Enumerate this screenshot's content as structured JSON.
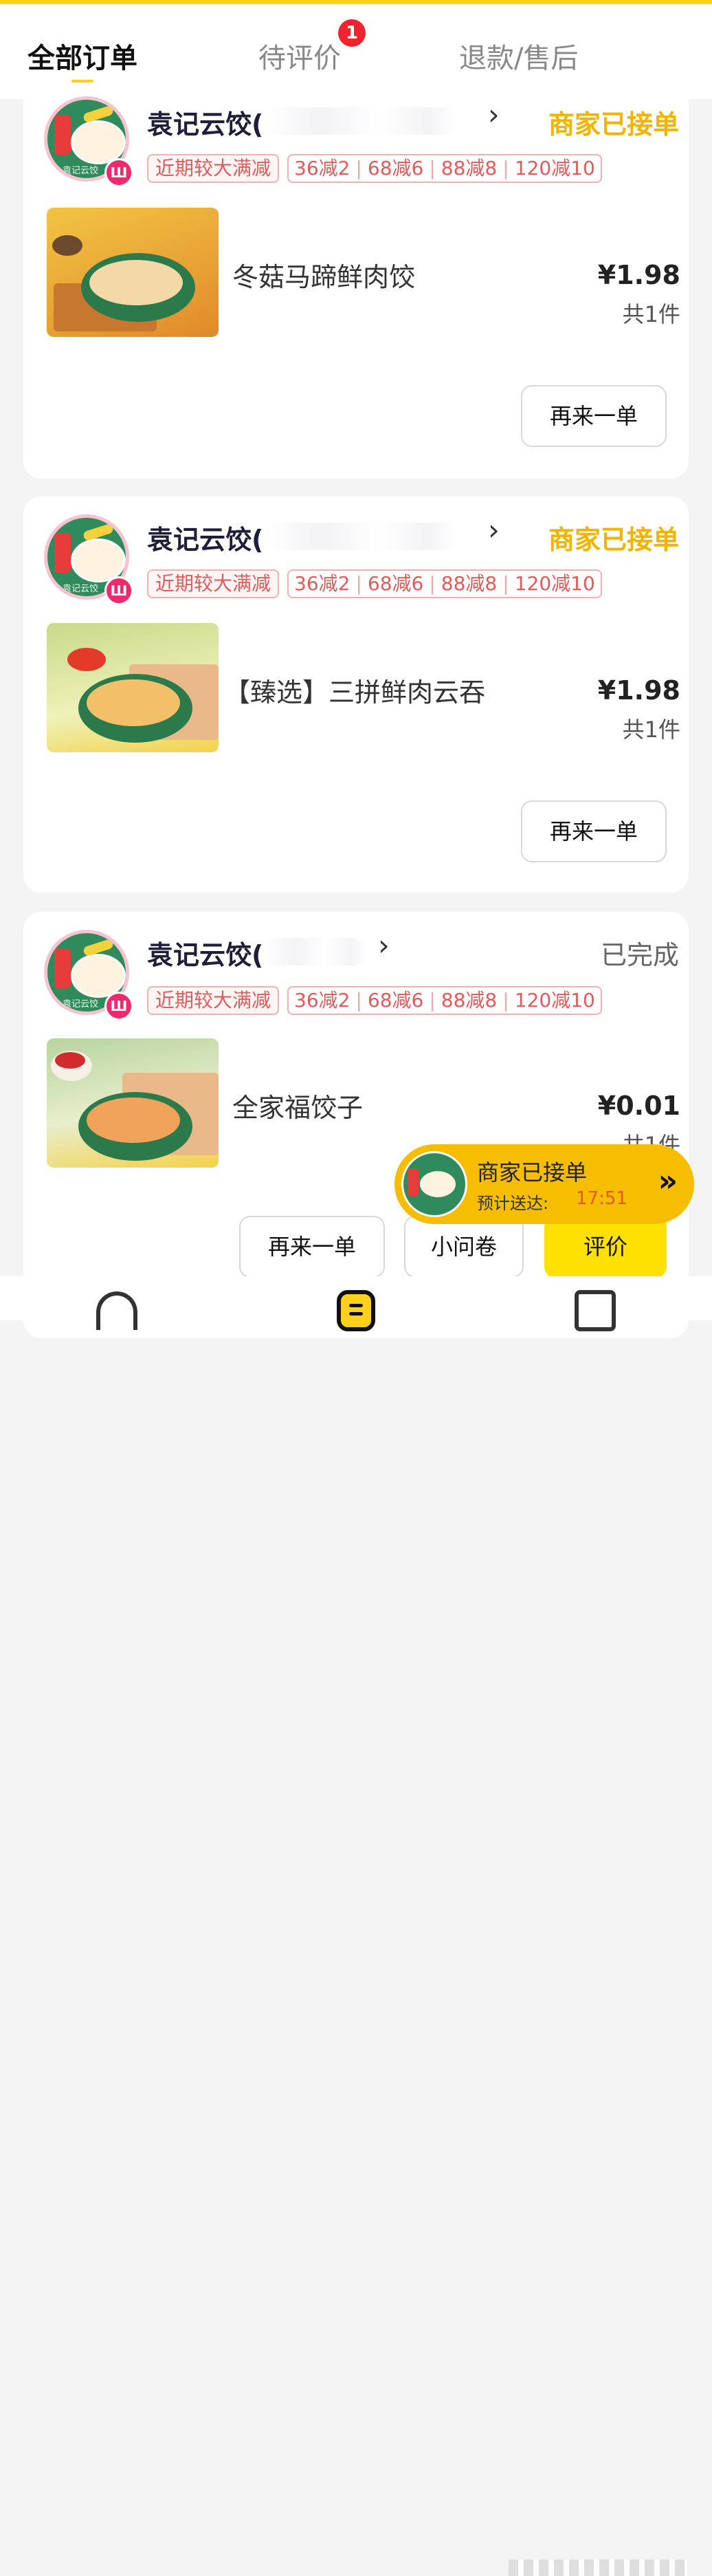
{
  "tabs": {
    "all": "全部订单",
    "review": "待评价",
    "review_badge": "1",
    "refund": "退款/售后"
  },
  "orders": [
    {
      "store_name": "袁记云饺(",
      "status": "商家已接单",
      "promo_label": "近期较大满减",
      "promos": [
        "36减2",
        "68减6",
        "88减8",
        "120减10"
      ],
      "dish_name": "冬菇马蹄鲜肉饺",
      "price": "¥1.98",
      "qty": "共1件",
      "reorder": "再来一单"
    },
    {
      "store_name": "袁记云饺(",
      "status": "商家已接单",
      "promo_label": "近期较大满减",
      "promos": [
        "36减2",
        "68减6",
        "88减8",
        "120减10"
      ],
      "dish_name": "【臻选】三拼鲜肉云吞",
      "price": "¥1.98",
      "qty": "共1件",
      "reorder": "再来一单"
    },
    {
      "store_name": "袁记云饺(",
      "status": "已完成",
      "promo_label": "近期较大满减",
      "promos": [
        "36减2",
        "68减6",
        "88减8",
        "120减10"
      ],
      "dish_name": "全家福饺子",
      "price": "¥0.01",
      "qty": "共1件",
      "reorder": "再来一单",
      "survey": "小问卷",
      "review": "评价"
    }
  ],
  "floating": {
    "title": "商家已接单",
    "eta_label": "预计送达:",
    "eta_time": "17:51"
  },
  "logo_text": "袁记云饺",
  "colors": {
    "accent_yellow": "#ffd11a",
    "status_yellow": "#f3b400",
    "promo_red": "#e35a5a",
    "badge_red": "#f0232e"
  },
  "icons": {
    "chevron": "›",
    "double_chevron": "»",
    "store_badge": "Ш"
  }
}
